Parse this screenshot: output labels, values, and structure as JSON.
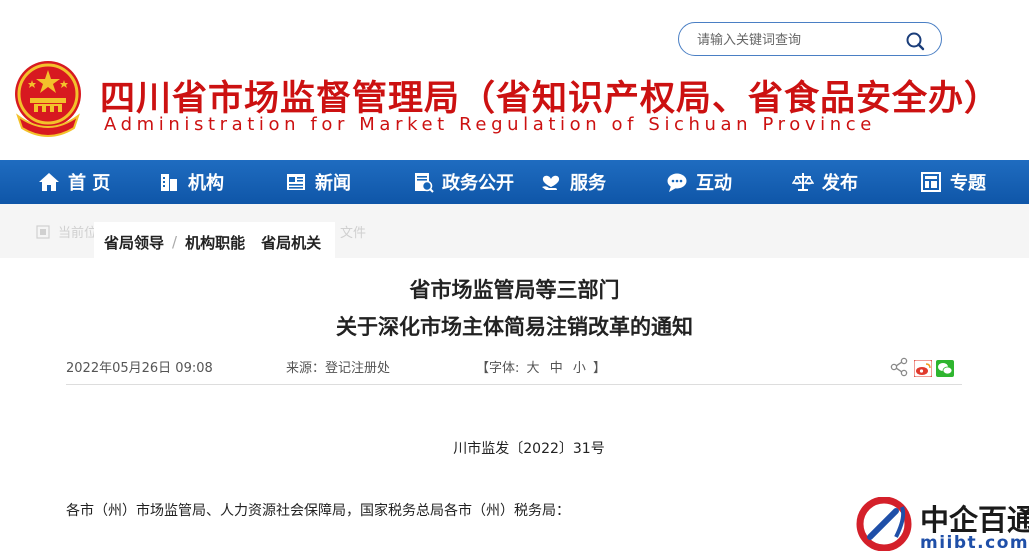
{
  "header": {
    "site_title": "四川省市场监督管理局（省知识产权局、省食品安全办）",
    "site_subtitle": "Administration for Market Regulation of Sichuan Province",
    "emblem_icon": "national-emblem-icon"
  },
  "search": {
    "placeholder": "请输入关键词查询",
    "icon": "search-icon"
  },
  "nav": {
    "items": [
      {
        "label": "首 页",
        "icon": "home-icon"
      },
      {
        "label": "机构",
        "icon": "building-icon"
      },
      {
        "label": "新闻",
        "icon": "news-icon"
      },
      {
        "label": "政务公开",
        "icon": "document-icon"
      },
      {
        "label": "服务",
        "icon": "heart-hand-icon"
      },
      {
        "label": "互动",
        "icon": "chat-icon"
      },
      {
        "label": "发布",
        "icon": "scale-icon"
      },
      {
        "label": "专题",
        "icon": "grid-icon"
      }
    ]
  },
  "breadcrumb": {
    "ghost_prefix": "当前位",
    "ghost_suffix": "文件"
  },
  "submenu": {
    "items": [
      "省局领导",
      "机构职能",
      "省局机关"
    ]
  },
  "article": {
    "title_line1": "省市场监管局等三部门",
    "title_line2": "关于深化市场主体简易注销改革的通知",
    "date": "2022年05月26日 09:08",
    "source": "来源：登记注册处",
    "font_label": "【字体:",
    "font_sizes": [
      "大",
      "中",
      "小"
    ],
    "font_close": "】",
    "doc_number": "川市监发〔2022〕31号",
    "salutation": "各市（州）市场监管局、人力资源社会保障局，国家税务总局各市（州）税务局："
  },
  "share": {
    "icons": [
      "share-icon",
      "weibo-icon",
      "wechat-icon"
    ]
  },
  "watermark": {
    "cn": "中企百通",
    "en": "miibt.com"
  },
  "colors": {
    "brand_red": "#cc1111",
    "nav_blue": "#1565b8",
    "watermark_blue": "#1f4fa8"
  }
}
